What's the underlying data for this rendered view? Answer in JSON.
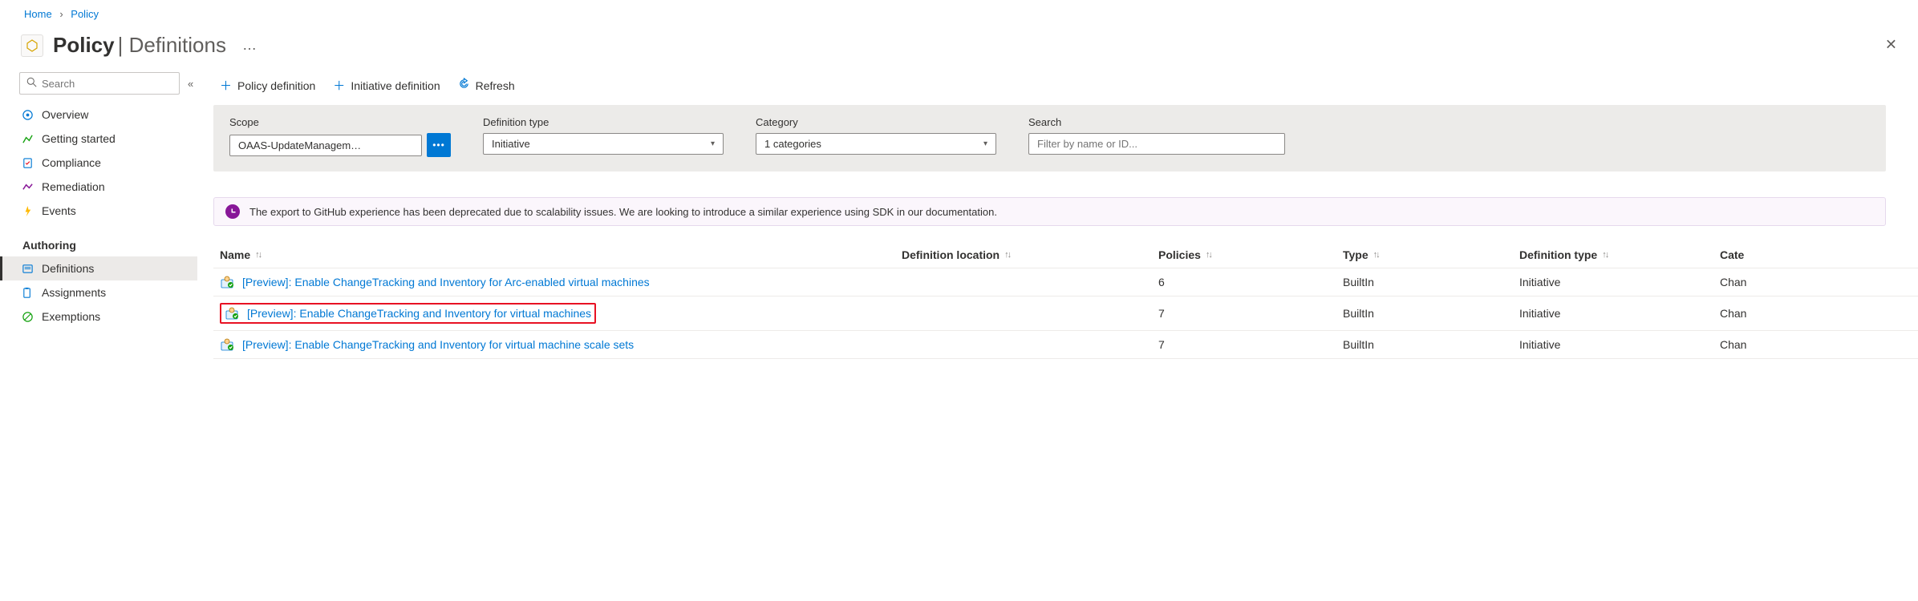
{
  "breadcrumb": {
    "home": "Home",
    "policy": "Policy"
  },
  "header": {
    "title": "Policy",
    "subtitle": "Definitions",
    "ellipsis": "…"
  },
  "sidebar": {
    "search_placeholder": "Search",
    "items": [
      {
        "label": "Overview"
      },
      {
        "label": "Getting started"
      },
      {
        "label": "Compliance"
      },
      {
        "label": "Remediation"
      },
      {
        "label": "Events"
      }
    ],
    "authoring_label": "Authoring",
    "authoring_items": [
      {
        "label": "Definitions"
      },
      {
        "label": "Assignments"
      },
      {
        "label": "Exemptions"
      }
    ]
  },
  "toolbar": {
    "policy_def": "Policy definition",
    "initiative_def": "Initiative definition",
    "refresh": "Refresh"
  },
  "filters": {
    "scope_label": "Scope",
    "scope_value": "OAAS-UpdateManagem…",
    "deftype_label": "Definition type",
    "deftype_value": "Initiative",
    "category_label": "Category",
    "category_value": "1 categories",
    "search_label": "Search",
    "search_placeholder": "Filter by name or ID..."
  },
  "notice": {
    "text": "The export to GitHub experience has been deprecated due to scalability issues. We are looking to introduce a similar experience using SDK in our documentation."
  },
  "grid": {
    "headers": {
      "name": "Name",
      "definition_location": "Definition location",
      "policies": "Policies",
      "type": "Type",
      "definition_type": "Definition type",
      "category": "Cate"
    },
    "rows": [
      {
        "name": "[Preview]: Enable ChangeTracking and Inventory for Arc-enabled virtual machines",
        "definition_location": "",
        "policies": "6",
        "type": "BuiltIn",
        "definition_type": "Initiative",
        "category": "Chan",
        "highlighted": false
      },
      {
        "name": "[Preview]: Enable ChangeTracking and Inventory for virtual machines",
        "definition_location": "",
        "policies": "7",
        "type": "BuiltIn",
        "definition_type": "Initiative",
        "category": "Chan",
        "highlighted": true
      },
      {
        "name": "[Preview]: Enable ChangeTracking and Inventory for virtual machine scale sets",
        "definition_location": "",
        "policies": "7",
        "type": "BuiltIn",
        "definition_type": "Initiative",
        "category": "Chan",
        "highlighted": false
      }
    ]
  }
}
